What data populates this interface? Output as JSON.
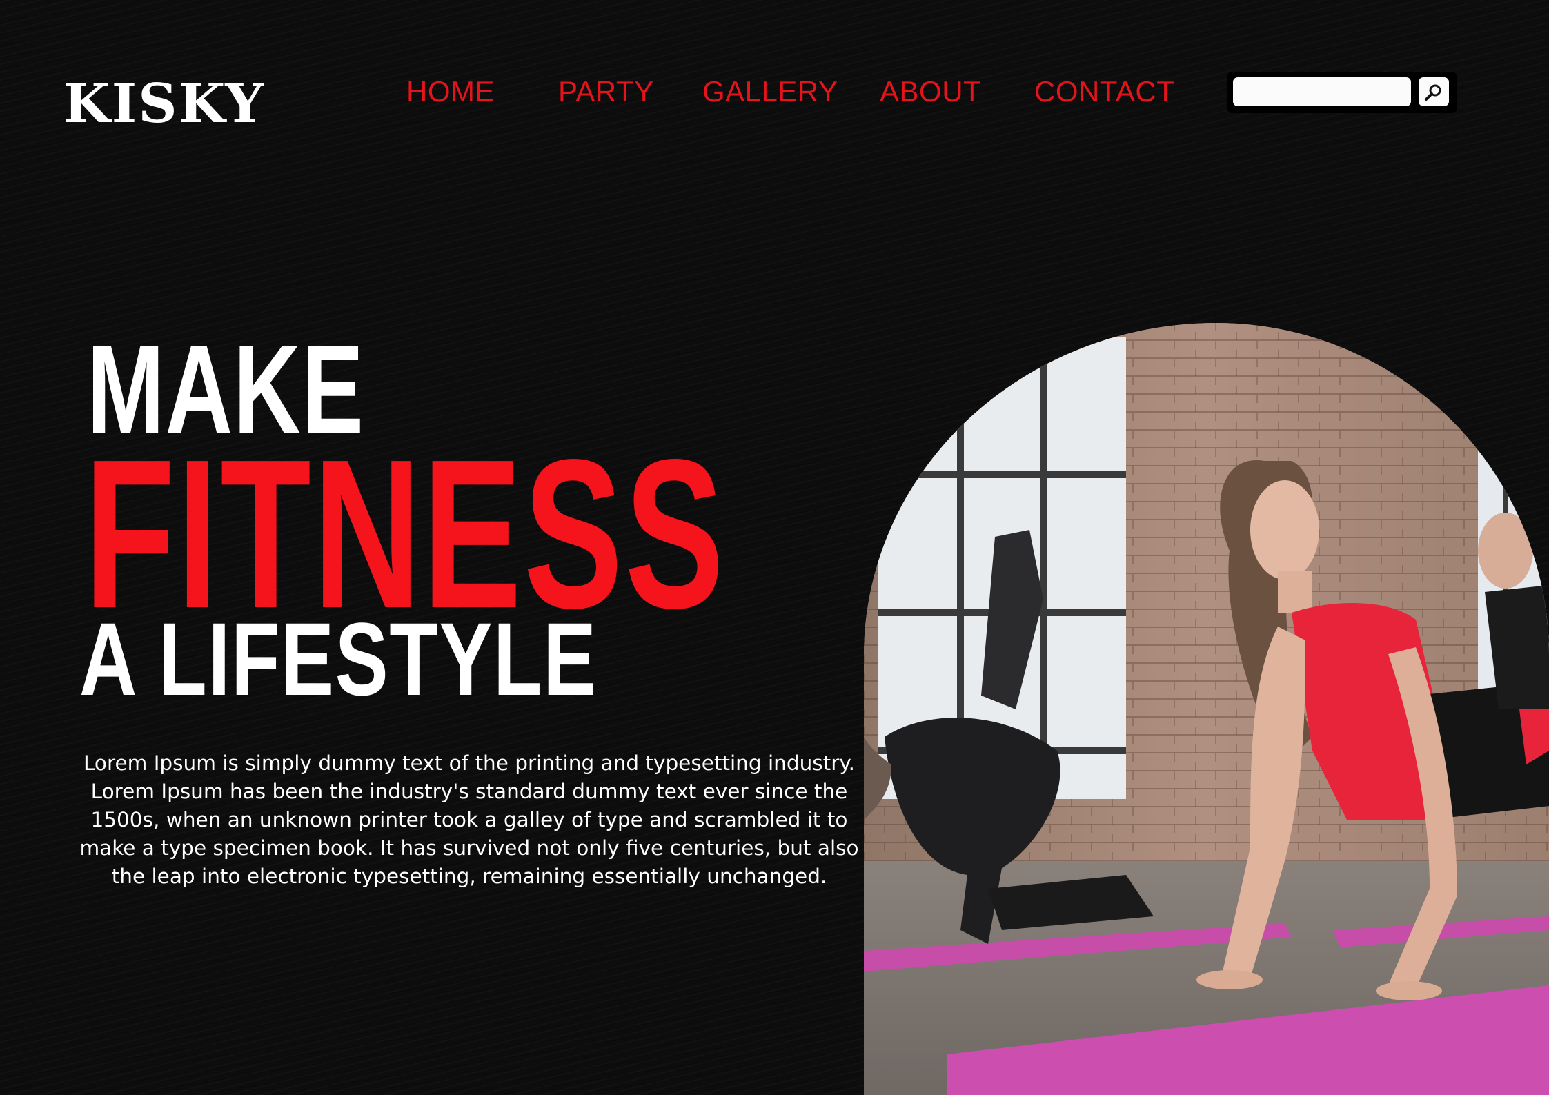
{
  "brand": {
    "logo": "KISKY"
  },
  "nav": {
    "items": [
      {
        "label": "HOME"
      },
      {
        "label": "PARTY"
      },
      {
        "label": "GALLERY"
      },
      {
        "label": "ABOUT"
      },
      {
        "label": "CONTACT"
      }
    ]
  },
  "search": {
    "value": "",
    "placeholder": "",
    "icon": "search-icon"
  },
  "hero": {
    "line1": "MAKE",
    "line2": "FITNESS",
    "line3": "A LIFESTYLE",
    "description": "Lorem Ipsum is simply dummy text of the printing and typesetting industry. Lorem Ipsum has been the industry's standard dummy text ever since the 1500s, when an unknown printer took a galley of type and scrambled it to make a type specimen book. It has survived not only five centuries, but also the leap into electronic typesetting, remaining essentially unchanged."
  },
  "colors": {
    "background": "#0d0d0e",
    "accent": "#f5141b",
    "nav_text": "#e5141b",
    "text": "#ffffff"
  }
}
